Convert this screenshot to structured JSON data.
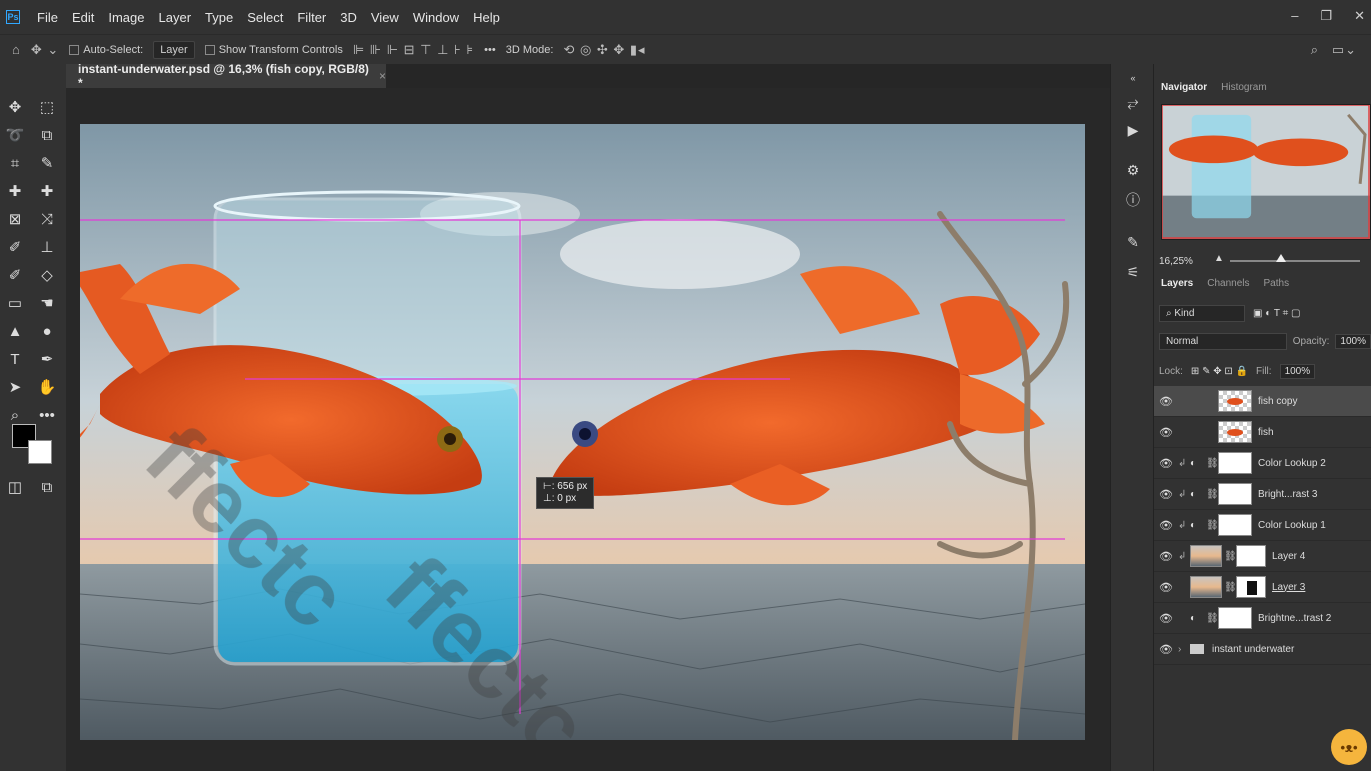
{
  "menu": {
    "items": [
      "File",
      "Edit",
      "Image",
      "Layer",
      "Type",
      "Select",
      "Filter",
      "3D",
      "View",
      "Window",
      "Help"
    ]
  },
  "options_bar": {
    "auto_select_label": "Auto-Select:",
    "auto_select_target": "Layer",
    "show_transform_label": "Show Transform Controls",
    "three_d_mode_label": "3D Mode:",
    "more_label": "•••"
  },
  "document": {
    "tab_title": "instant-underwater.psd @ 16,3% (fish copy, RGB/8) *",
    "close": "×"
  },
  "transform_readout": {
    "dx": "656 px",
    "dy": "0 px"
  },
  "navigator": {
    "tabs": [
      "Navigator",
      "Histogram"
    ],
    "zoom": "16,25%"
  },
  "layers_panel": {
    "tabs": [
      "Layers",
      "Channels",
      "Paths"
    ],
    "filter_kind": "Kind",
    "blend_mode": "Normal",
    "opacity_label": "Opacity:",
    "opacity_value": "100%",
    "lock_label": "Lock:",
    "fill_label": "Fill:",
    "fill_value": "100%",
    "layers": [
      {
        "name": "fish copy",
        "thumb": "checker",
        "selected": true
      },
      {
        "name": "fish",
        "thumb": "checker"
      },
      {
        "name": "Color Lookup 2",
        "thumb": "white",
        "adjustment": true,
        "clipped": true
      },
      {
        "name": "Bright...rast 3",
        "thumb": "white",
        "adjustment": true,
        "clipped": true
      },
      {
        "name": "Color Lookup 1",
        "thumb": "white",
        "adjustment": true,
        "clipped": true
      },
      {
        "name": "Layer 4",
        "thumb": "photo",
        "mask": true,
        "clipped": true
      },
      {
        "name": "Layer 3",
        "thumb": "photo",
        "mask": true,
        "mask_dark": true
      },
      {
        "name": "Brightne...trast 2",
        "thumb": "white",
        "adjustment": true
      },
      {
        "name": "instant underwater",
        "group": true
      }
    ]
  },
  "colors": {
    "accent": "#31a8ff",
    "guide": "#e23bd6",
    "fish": "#e0501d"
  }
}
